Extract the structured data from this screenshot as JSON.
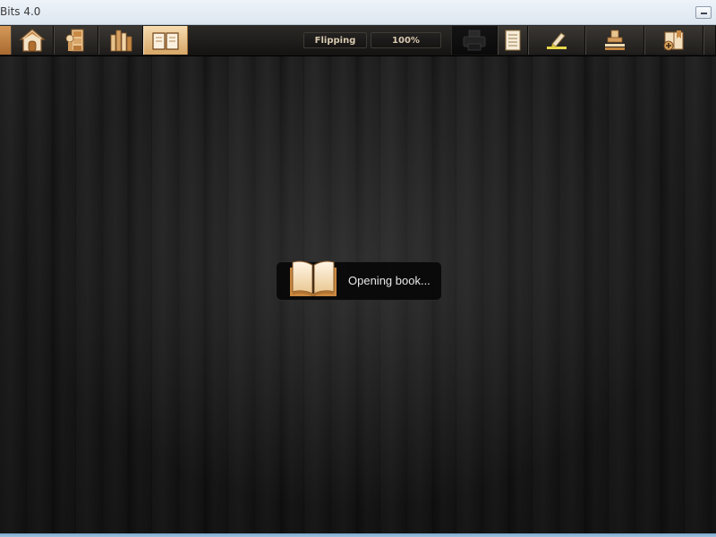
{
  "window": {
    "title": "Bits 4.0"
  },
  "toolbar": {
    "left_buttons": [
      {
        "name": "home",
        "icon": "home-icon"
      },
      {
        "name": "library",
        "icon": "bookshelf-icon"
      },
      {
        "name": "books",
        "icon": "books-icon"
      },
      {
        "name": "reader",
        "icon": "open-book-icon",
        "active": true
      }
    ],
    "mode_label": "Flipping",
    "zoom_label": "100%",
    "right_buttons": [
      {
        "name": "print",
        "icon": "printer-icon"
      },
      {
        "name": "notes",
        "icon": "notepad-icon"
      },
      {
        "name": "highlight",
        "icon": "highlighter-icon"
      },
      {
        "name": "stamp",
        "icon": "stamp-icon"
      },
      {
        "name": "add-bookmark",
        "icon": "add-bookmark-icon"
      }
    ]
  },
  "loading": {
    "message": "Opening book...",
    "icon": "open-book-icon"
  },
  "colors": {
    "accent": "#d7a767",
    "toolbar_bg": "#1f1d1b",
    "titlebar_bg": "#dde6f0"
  }
}
